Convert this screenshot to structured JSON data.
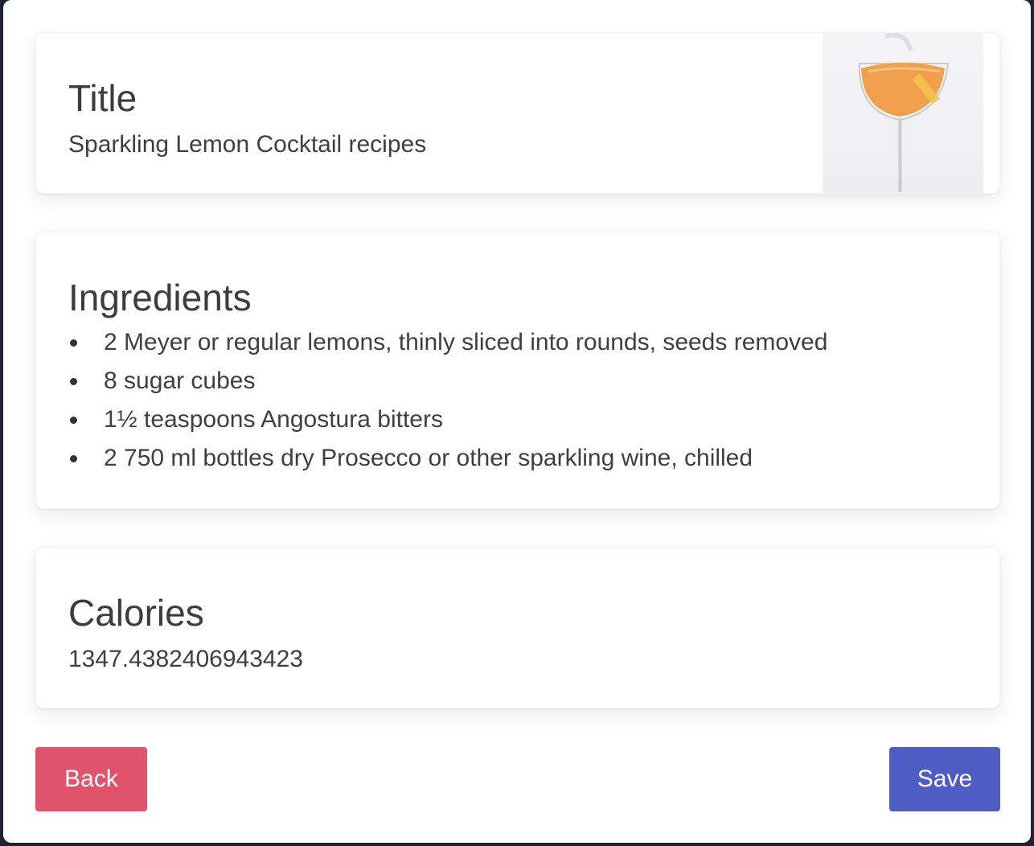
{
  "title_card": {
    "heading": "Title",
    "value": "Sparkling Lemon Cocktail recipes",
    "image_icon": "cocktail-glass-photo"
  },
  "ingredients_card": {
    "heading": "Ingredients",
    "items": [
      "2 Meyer or regular lemons, thinly sliced into rounds, seeds removed",
      "8 sugar cubes",
      "1½ teaspoons Angostura bitters",
      "2 750 ml bottles dry Prosecco or other sparkling wine, chilled"
    ]
  },
  "calories_card": {
    "heading": "Calories",
    "value": "1347.4382406943423"
  },
  "buttons": {
    "back_label": "Back",
    "save_label": "Save"
  },
  "colors": {
    "back": "#e0536a",
    "save": "#4e5dc3",
    "text": "#3f3f3f"
  }
}
